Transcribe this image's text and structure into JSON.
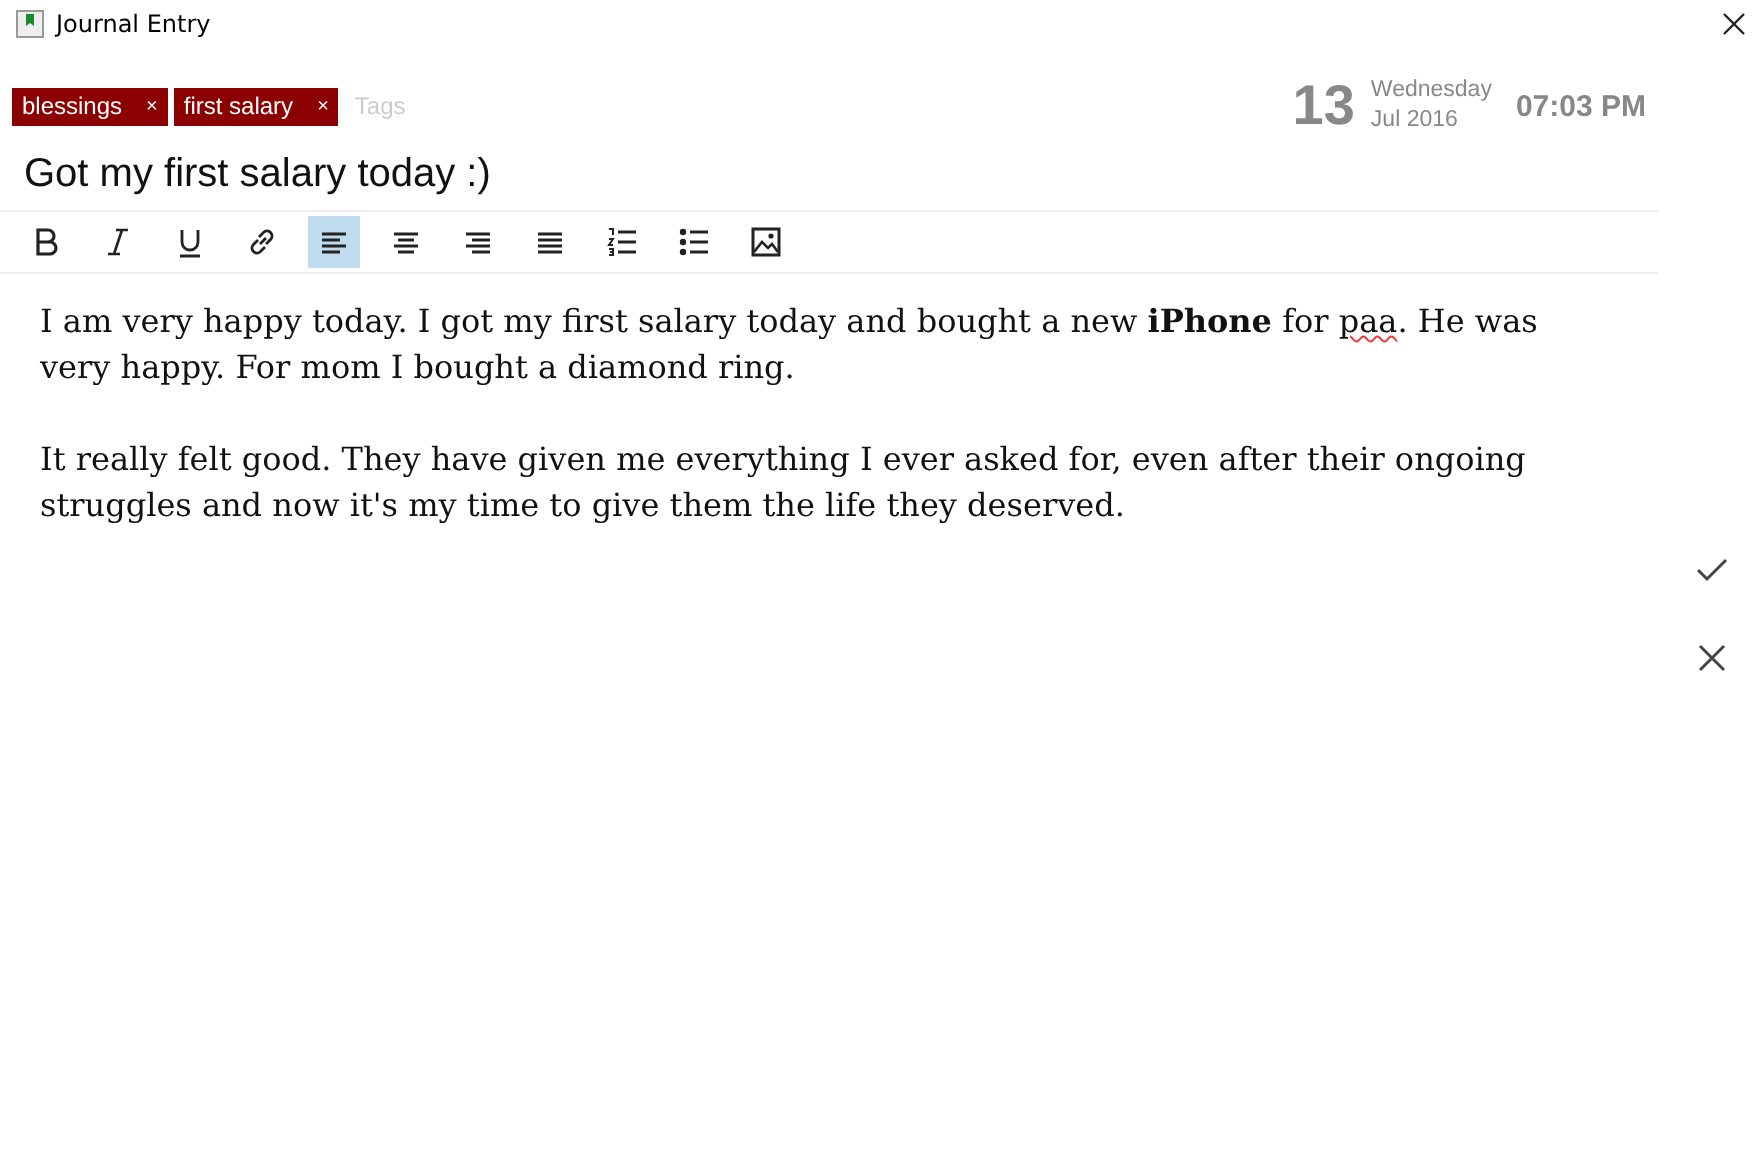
{
  "window": {
    "title": "Journal Entry"
  },
  "tags": {
    "items": [
      {
        "label": "blessings",
        "remove": "×"
      },
      {
        "label": "first salary",
        "remove": "×"
      }
    ],
    "placeholder": "Tags"
  },
  "date": {
    "day": "13",
    "weekday": "Wednesday",
    "month_year": "Jul 2016",
    "time": "07:03 PM"
  },
  "title": {
    "value": "Got my first salary today :)"
  },
  "toolbar": [
    {
      "kind": "bold",
      "selected": false
    },
    {
      "kind": "italic",
      "selected": false
    },
    {
      "kind": "underline",
      "selected": false
    },
    {
      "kind": "link",
      "selected": false
    },
    {
      "kind": "align-left",
      "selected": true
    },
    {
      "kind": "align-center",
      "selected": false
    },
    {
      "kind": "align-right",
      "selected": false
    },
    {
      "kind": "justify",
      "selected": false
    },
    {
      "kind": "numbered-list",
      "selected": false
    },
    {
      "kind": "bulleted-list",
      "selected": false
    },
    {
      "kind": "image",
      "selected": false
    }
  ],
  "body": [
    [
      {
        "text": "I am very happy today. I got my first salary today and bought a new ",
        "bold": false,
        "misspelled": false
      },
      {
        "text": "iPhone",
        "bold": true,
        "misspelled": false
      },
      {
        "text": " for ",
        "bold": false,
        "misspelled": false
      },
      {
        "text": "paa",
        "bold": false,
        "misspelled": true
      },
      {
        "text": ". He was very happy. For mom I bought a diamond ring.",
        "bold": false,
        "misspelled": false
      }
    ],
    [
      {
        "text": "It really felt good. They have given me everything I ever asked for, even after their ongoing struggles and now it's my time to give them the life they deserved.",
        "bold": false,
        "misspelled": false
      }
    ]
  ]
}
